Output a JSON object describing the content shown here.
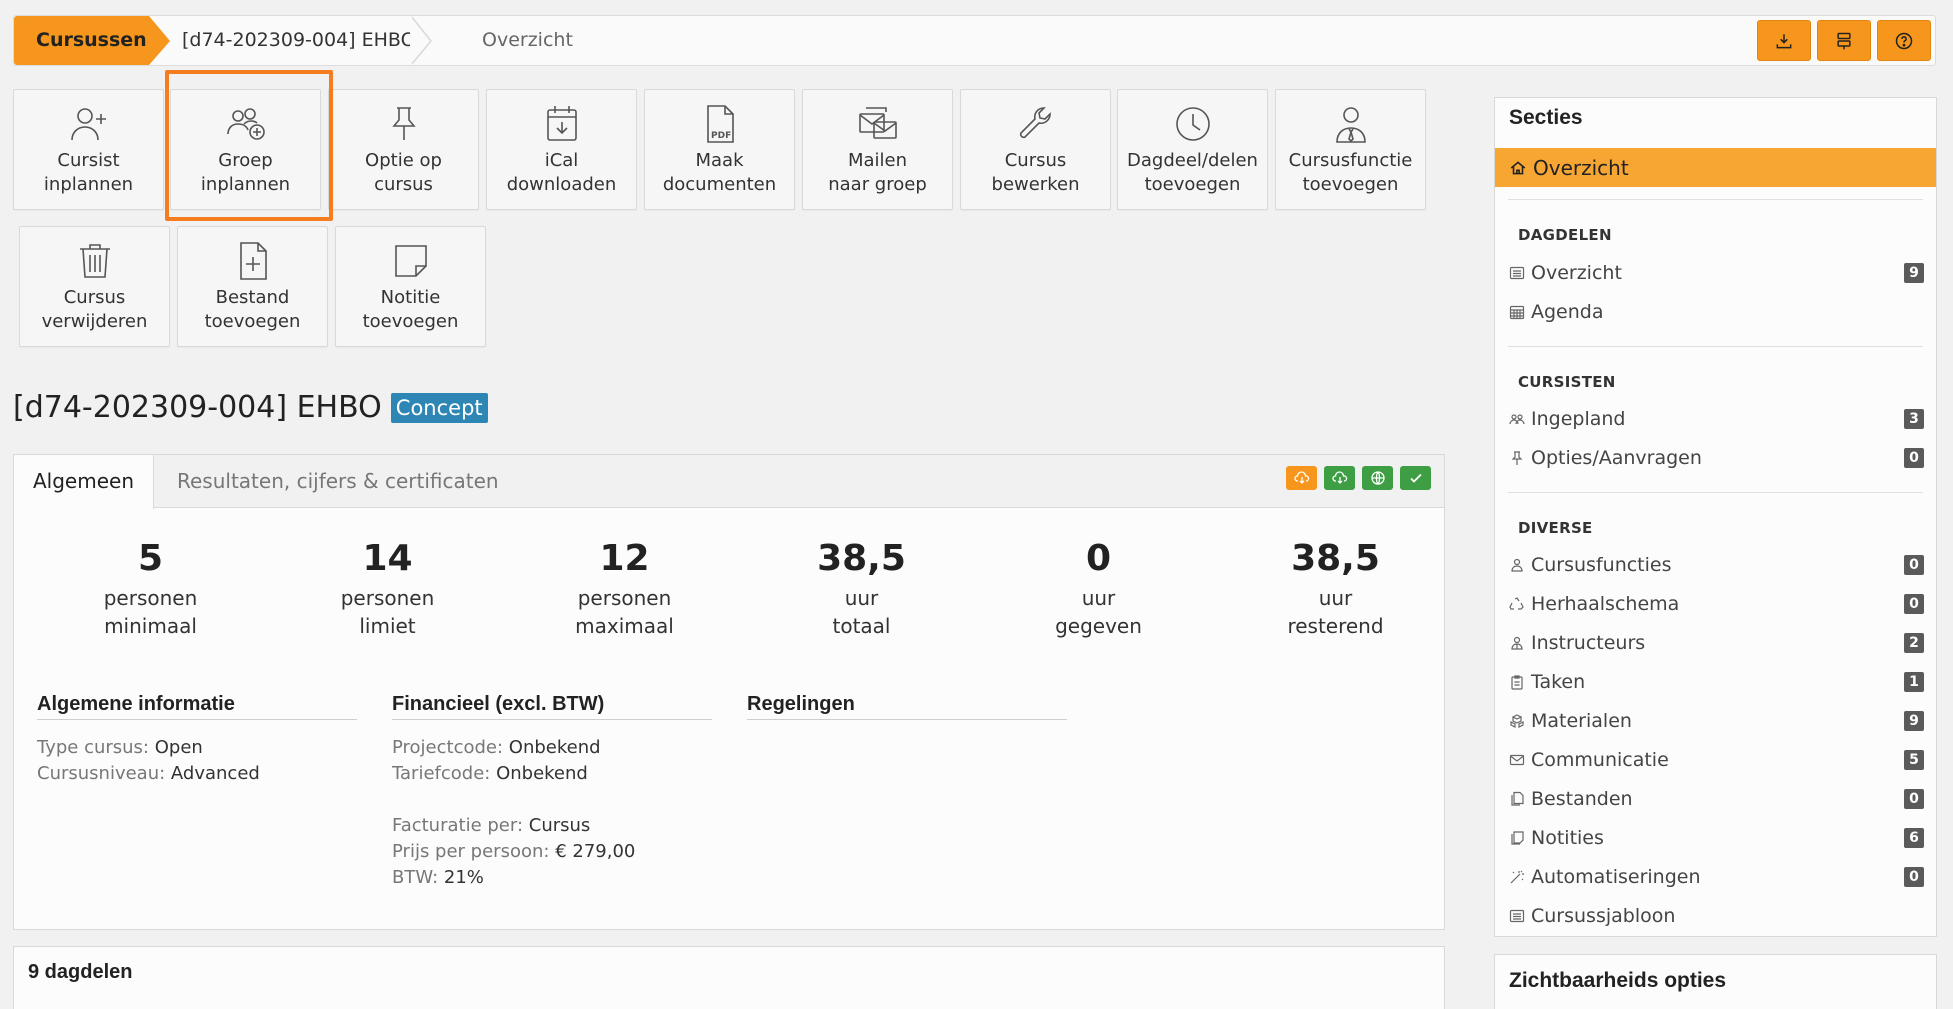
{
  "breadcrumb": {
    "home": "Cursussen",
    "course": "[d74-202309-004] EHBO",
    "current": "Overzicht"
  },
  "top_actions": [
    "download-icon",
    "layout-icon",
    "help-icon"
  ],
  "tiles": [
    {
      "label": "Cursist\ninplannen",
      "icon": "user-plus-icon"
    },
    {
      "label": "Groep\ninplannen",
      "icon": "group-plus-icon"
    },
    {
      "label": "Optie op\ncursus",
      "icon": "pin-icon"
    },
    {
      "label": "iCal\ndownloaden",
      "icon": "calendar-download-icon"
    },
    {
      "label": "Maak\ndocumenten",
      "icon": "pdf-icon"
    },
    {
      "label": "Mailen\nnaar groep",
      "icon": "mail-group-icon"
    },
    {
      "label": "Cursus\nbewerken",
      "icon": "wrench-icon"
    },
    {
      "label": "Dagdeel/delen\ntoevoegen",
      "icon": "clock-icon"
    },
    {
      "label": "Cursusfunctie\ntoevoegen",
      "icon": "user-tie-icon"
    },
    {
      "label": "Cursus\nverwijderen",
      "icon": "trash-icon"
    },
    {
      "label": "Bestand\ntoevoegen",
      "icon": "file-plus-icon"
    },
    {
      "label": "Notitie\ntoevoegen",
      "icon": "note-icon"
    }
  ],
  "title": {
    "text": "[d74-202309-004] EHBO",
    "status": "Concept"
  },
  "tabs": {
    "general": "Algemeen",
    "results": "Resultaten, cijfers & certificaten"
  },
  "stats": [
    {
      "value": "5",
      "caption": "personen\nminimaal"
    },
    {
      "value": "14",
      "caption": "personen\nlimiet"
    },
    {
      "value": "12",
      "caption": "personen\nmaximaal"
    },
    {
      "value": "38,5",
      "caption": "uur\ntotaal"
    },
    {
      "value": "0",
      "caption": "uur\ngegeven"
    },
    {
      "value": "38,5",
      "caption": "uur\nresterend"
    }
  ],
  "info": {
    "general": {
      "heading": "Algemene informatie",
      "type_key": "Type cursus:",
      "type_val": "Open",
      "level_key": "Cursusniveau:",
      "level_val": "Advanced"
    },
    "finance": {
      "heading": "Financieel (excl. BTW)",
      "project_key": "Projectcode:",
      "project_val": "Onbekend",
      "tarief_key": "Tariefcode:",
      "tarief_val": "Onbekend",
      "billing_key": "Facturatie per:",
      "billing_val": "Cursus",
      "price_key": "Prijs per persoon:",
      "price_val": "€ 279,00",
      "vat_key": "BTW:",
      "vat_val": "21%"
    },
    "rules": {
      "heading": "Regelingen"
    }
  },
  "dagdelen_panel": {
    "heading": "9 dagdelen"
  },
  "sidebar": {
    "title": "Secties",
    "active": "Overzicht",
    "sections": {
      "dagdelen": "DAGDELEN",
      "cursisten": "CURSISTEN",
      "diverse": "DIVERSE"
    },
    "items": {
      "overzicht": {
        "label": "Overzicht",
        "count": "9"
      },
      "agenda": {
        "label": "Agenda"
      },
      "ingepland": {
        "label": "Ingepland",
        "count": "3"
      },
      "opties": {
        "label": "Opties/Aanvragen",
        "count": "0"
      },
      "cursusfuncties": {
        "label": "Cursusfuncties",
        "count": "0"
      },
      "herhaalschema": {
        "label": "Herhaalschema",
        "count": "0"
      },
      "instructeurs": {
        "label": "Instructeurs",
        "count": "2"
      },
      "taken": {
        "label": "Taken",
        "count": "1"
      },
      "materialen": {
        "label": "Materialen",
        "count": "9"
      },
      "communicatie": {
        "label": "Communicatie",
        "count": "5"
      },
      "bestanden": {
        "label": "Bestanden",
        "count": "0"
      },
      "notities": {
        "label": "Notities",
        "count": "6"
      },
      "automatiseringen": {
        "label": "Automatiseringen",
        "count": "0"
      },
      "cursussjabloon": {
        "label": "Cursussjabloon"
      }
    }
  },
  "visibility": {
    "title": "Zichtbaarheids opties"
  },
  "colors": {
    "accent": "#f7961c",
    "status": "#2e86b5",
    "green": "#3e9e44",
    "highlight": "#f57c1f"
  }
}
